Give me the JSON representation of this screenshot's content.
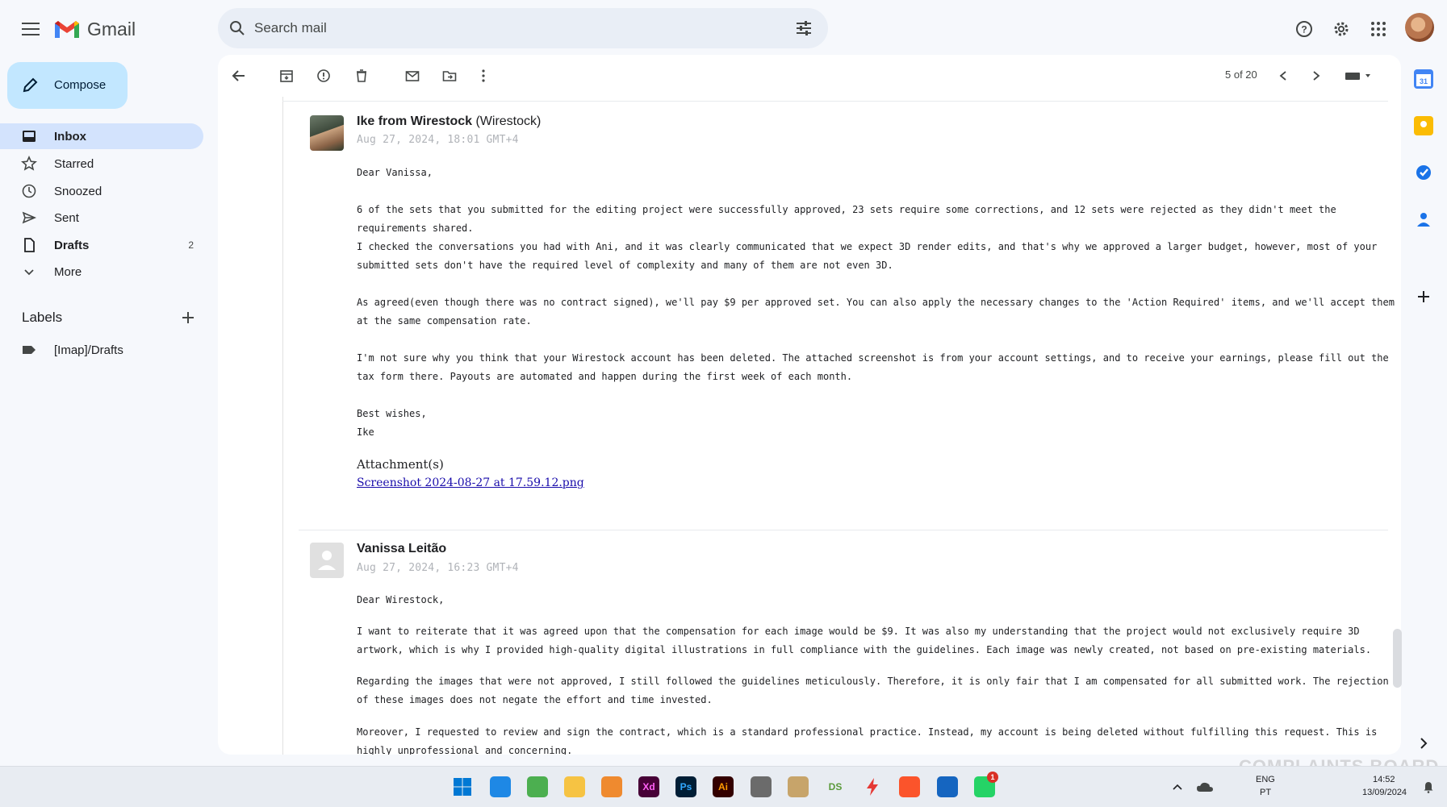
{
  "app": {
    "name": "Gmail"
  },
  "search": {
    "placeholder": "Search mail"
  },
  "compose": {
    "label": "Compose"
  },
  "nav": [
    {
      "label": "Inbox",
      "count": "",
      "active": true,
      "bold": true,
      "icon": "inbox-icon"
    },
    {
      "label": "Starred",
      "count": "",
      "icon": "star-icon"
    },
    {
      "label": "Snoozed",
      "count": "",
      "icon": "clock-icon"
    },
    {
      "label": "Sent",
      "count": "",
      "icon": "send-icon"
    },
    {
      "label": "Drafts",
      "count": "2",
      "bold": true,
      "icon": "file-icon"
    },
    {
      "label": "More",
      "count": "",
      "icon": "chevron-down-icon"
    }
  ],
  "labels": {
    "title": "Labels",
    "items": [
      {
        "label": "[Imap]/Drafts"
      }
    ]
  },
  "toolbar": {
    "pager": "5 of 20"
  },
  "messages": [
    {
      "sender_name": "Ike from Wirestock",
      "sender_org": "(Wirestock)",
      "date": "Aug 27, 2024, 18:01 GMT+4",
      "paragraphs": [
        "Dear Vanissa,",
        "6 of the sets that you submitted for the editing project were successfully approved, 23 sets require some corrections, and 12 sets were rejected as they didn't meet the requirements shared.",
        "I checked the conversations you had with Ani, and it was clearly communicated that we expect 3D render edits, and that's why we approved a larger budget, however, most of your submitted sets don't have the required level of complexity and many of them are not even 3D.",
        "As agreed(even though there was no contract signed), we'll pay $9 per approved set. You can also apply the necessary changes to the 'Action Required' items, and we'll accept them at the same compensation rate.",
        "I'm not sure why you think that your Wirestock account has been deleted. The attached screenshot is from your account settings, and to receive your earnings, please fill out the tax form there. Payouts are automated and happen during the first week of each month.",
        "Best wishes,",
        "Ike"
      ],
      "attachments_label": "Attachment(s)",
      "attachment": "Screenshot 2024-08-27 at 17.59.12.png"
    },
    {
      "sender_name": "Vanissa Leitão",
      "date": "Aug 27, 2024, 16:23 GMT+4",
      "paragraphs": [
        "Dear Wirestock,",
        "I want to reiterate that it was agreed upon that the compensation for each image would be $9. It was also my understanding that the project would not exclusively require 3D artwork, which is why I provided high-quality digital illustrations in full compliance with the guidelines. Each image was newly created, not based on pre-existing materials.",
        "Regarding the images that were not approved, I still followed the guidelines meticulously. Therefore, it is only fair that I am compensated for all submitted work. The rejection of these images does not negate the effort and time invested.",
        "Moreover, I requested to review and sign the contract, which is a standard professional practice. Instead, my account is being deleted without fulfilling this request. This is highly unprofessional and concerning."
      ]
    }
  ],
  "taskbar": {
    "apps": [
      "Xd",
      "Ps",
      "Ai",
      "DS"
    ],
    "whatsapp_badge": "1",
    "lang": "ENG",
    "lang_sub": "PT",
    "time": "14:52",
    "date": "13/09/2024"
  },
  "watermark": "COMPLAINTS BOARD",
  "colors": {
    "accent": "#0b57d0",
    "compose_bg": "#c2e7ff",
    "active_nav": "#d3e3fd",
    "link": "#1a0dab"
  }
}
